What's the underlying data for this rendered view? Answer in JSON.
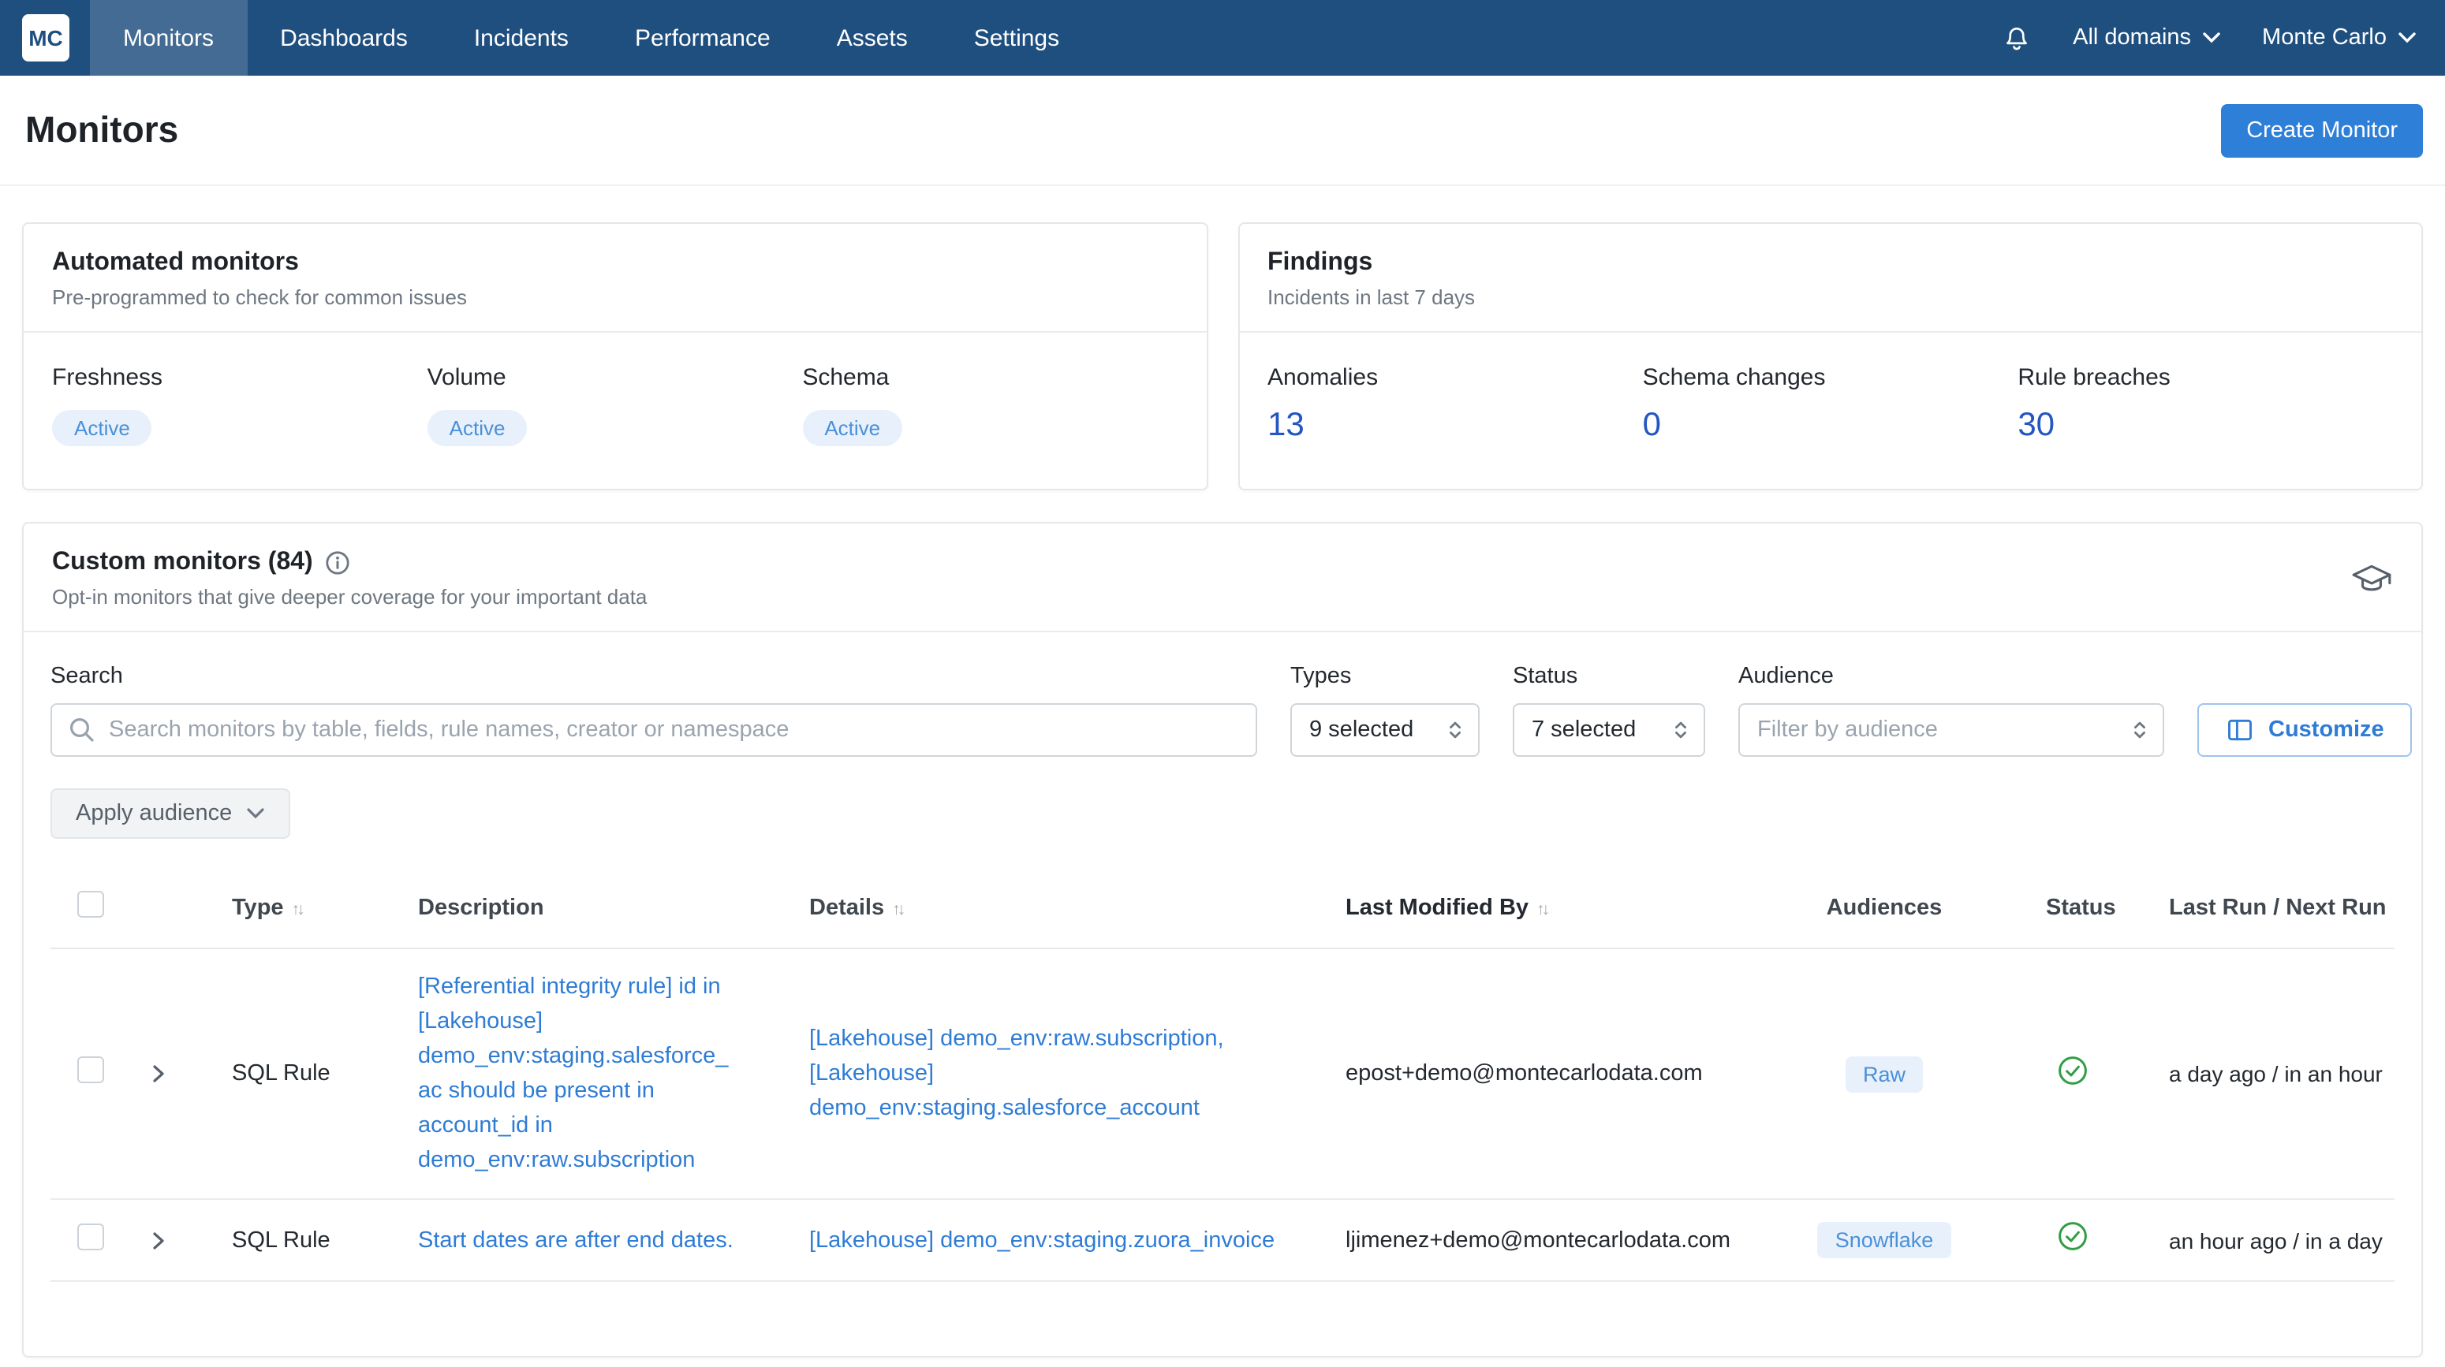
{
  "navbar": {
    "logo_text": "MC",
    "items": [
      {
        "label": "Monitors"
      },
      {
        "label": "Dashboards"
      },
      {
        "label": "Incidents"
      },
      {
        "label": "Performance"
      },
      {
        "label": "Assets"
      },
      {
        "label": "Settings"
      }
    ],
    "domain_selector": "All domains",
    "account_name": "Monte Carlo"
  },
  "page_header": {
    "title": "Monitors",
    "create_button": "Create Monitor"
  },
  "automated_monitors": {
    "title": "Automated monitors",
    "subtitle": "Pre-programmed to check for common issues",
    "monitors": [
      {
        "label": "Freshness",
        "status": "Active"
      },
      {
        "label": "Volume",
        "status": "Active"
      },
      {
        "label": "Schema",
        "status": "Active"
      }
    ]
  },
  "findings": {
    "title": "Findings",
    "subtitle": "Incidents in last 7 days",
    "metrics": [
      {
        "label": "Anomalies",
        "value": "13"
      },
      {
        "label": "Schema changes",
        "value": "0"
      },
      {
        "label": "Rule breaches",
        "value": "30"
      }
    ]
  },
  "custom_monitors": {
    "title": "Custom monitors (84)",
    "subtitle": "Opt-in monitors that give deeper coverage for your important data",
    "filters": {
      "search_label": "Search",
      "search_placeholder": "Search monitors by table, fields, rule names, creator or namespace",
      "types_label": "Types",
      "types_value": "9 selected",
      "status_label": "Status",
      "status_value": "7 selected",
      "audience_label": "Audience",
      "audience_placeholder": "Filter by audience",
      "customize_button": "Customize",
      "apply_audience_button": "Apply audience"
    },
    "table": {
      "sort_glyph": "↑↓",
      "columns": {
        "type": "Type",
        "description": "Description",
        "details": "Details",
        "last_modified_by": "Last Modified By",
        "audiences": "Audiences",
        "status": "Status",
        "last_run": "Last Run / Next Run"
      },
      "rows": [
        {
          "type": "SQL Rule",
          "description": "[Referential integrity rule] id in [Lakehouse] demo_env:staging.salesforce_ac should be present in account_id in demo_env:raw.subscription",
          "details": "[Lakehouse] demo_env:raw.subscription, [Lakehouse] demo_env:staging.salesforce_account",
          "last_modified_by": "epost+demo@montecarlodata.com",
          "audience": "Raw",
          "status": "passing",
          "last_run": "a day ago / in an hour"
        },
        {
          "type": "SQL Rule",
          "description": "Start dates are after end dates.",
          "details": "[Lakehouse] demo_env:staging.zuora_invoice",
          "last_modified_by": "ljimenez+demo@montecarlodata.com",
          "audience": "Snowflake",
          "status": "passing",
          "last_run": "an hour ago / in a day"
        }
      ]
    }
  },
  "colors": {
    "navbar_bg": "#1f4f7f",
    "accent_blue": "#2e7cd6",
    "badge_bg": "#e8f1fb",
    "badge_text": "#4a90d9",
    "metric_blue": "#2456c2",
    "success_green": "#2f9e44"
  }
}
